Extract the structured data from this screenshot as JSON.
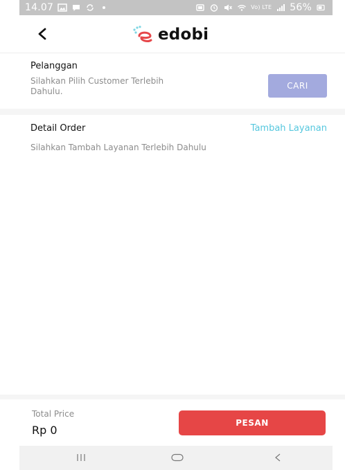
{
  "status_bar": {
    "time": "14.07",
    "battery": "56%",
    "network_label": "Vo) LTE",
    "icons_left": [
      "gallery-icon",
      "chat-icon",
      "sync-icon",
      "dot-icon"
    ],
    "icons_right": [
      "sim-icon",
      "alarm-icon",
      "mute-icon",
      "wifi-icon",
      "volte-icon",
      "signal-icon",
      "battery-icon"
    ]
  },
  "header": {
    "back_icon": "back-arrow-icon",
    "logo_text": "edobi",
    "logo_colors": {
      "accent": "#e6474a",
      "accent_light": "#7ed6e3"
    }
  },
  "customer": {
    "title": "Pelanggan",
    "hint": "Silahkan Pilih Customer Terlebih Dahulu.",
    "search_label": "CARI",
    "search_color": "#a3aade"
  },
  "order": {
    "title": "Detail Order",
    "add_service_label": "Tambah Layanan",
    "add_service_color": "#55c7de",
    "empty_hint": "Silahkan Tambah Layanan Terlebih Dahulu"
  },
  "footer": {
    "total_label": "Total Price",
    "total_value": "Rp 0",
    "order_label": "PESAN",
    "order_color": "#e64646"
  },
  "nav_bar": {
    "items": [
      "recent-apps-icon",
      "home-icon",
      "back-icon"
    ]
  }
}
